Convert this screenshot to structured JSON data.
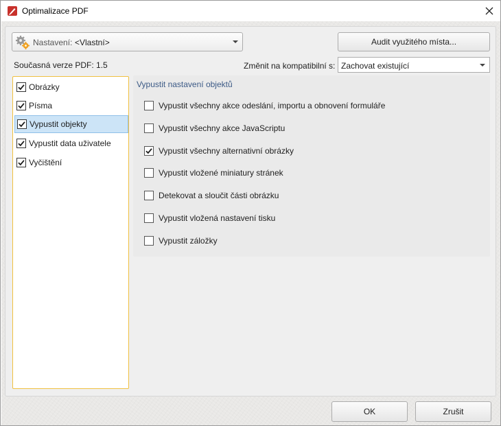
{
  "window": {
    "title": "Optimalizace PDF",
    "icons": {
      "app": "pdf-app-icon",
      "close": "close-icon"
    }
  },
  "header": {
    "settings_label": "Nastavení:",
    "settings_value": "<Vlastní>",
    "audit_button": "Audit využitého místa...",
    "version_label": "Současná verze PDF: 1.5",
    "compat_label": "Změnit na kompatibilní s:",
    "compat_value": "Zachovat existující"
  },
  "categories": [
    {
      "label": "Obrázky",
      "checked": true,
      "selected": false
    },
    {
      "label": "Písma",
      "checked": true,
      "selected": false
    },
    {
      "label": "Vypustit objekty",
      "checked": true,
      "selected": true
    },
    {
      "label": "Vypustit data uživatele",
      "checked": true,
      "selected": false
    },
    {
      "label": "Vyčištění",
      "checked": true,
      "selected": false
    }
  ],
  "options_group": {
    "title": "Vypustit nastavení objektů",
    "options": [
      {
        "label": "Vypustit všechny akce odeslání, importu a obnovení formuláře",
        "checked": false
      },
      {
        "label": "Vypustit všechny akce JavaScriptu",
        "checked": false
      },
      {
        "label": "Vypustit všechny alternativní obrázky",
        "checked": true
      },
      {
        "label": "Vypustit vložené miniatury stránek",
        "checked": false
      },
      {
        "label": "Detekovat a sloučit části obrázku",
        "checked": false
      },
      {
        "label": "Vypustit vložená nastavení tisku",
        "checked": false
      },
      {
        "label": "Vypustit záložky",
        "checked": false
      }
    ]
  },
  "footer": {
    "ok_label": "OK",
    "cancel_label": "Zrušit"
  },
  "colors": {
    "accent_border": "#f0c040",
    "selection": "#cce4f7",
    "group_title": "#3c5a86"
  }
}
